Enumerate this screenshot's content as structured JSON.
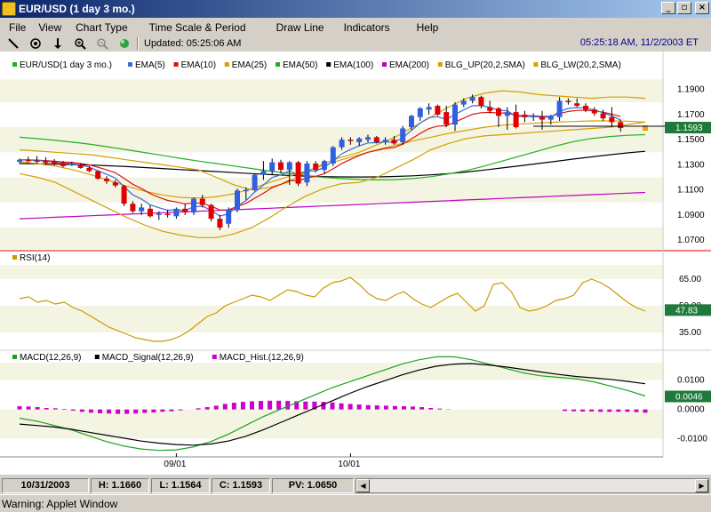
{
  "window": {
    "title": "EUR/USD (1 day  3 mo.)",
    "minimize": "_",
    "restore": "▫",
    "close": "×"
  },
  "menu": [
    "File",
    "View",
    "Chart Type",
    "Time Scale & Period",
    "Draw Line",
    "Indicators",
    "Help"
  ],
  "toolbar": {
    "tools": [
      "pencil-icon",
      "crosshair-icon",
      "arrow-down-icon",
      "zoom-in-icon",
      "zoom-out-icon",
      "globe-icon"
    ],
    "updated": "Updated: 05:25:06 AM",
    "clock": "05:25:18 AM, 11/2/2003 ET"
  },
  "colors": {
    "ema5": "#3b6bd6",
    "ema10": "#e01010",
    "ema25": "#d6a000",
    "ema50": "#20b020",
    "ema100": "#000000",
    "ema200": "#c000c0",
    "bb": "#d0a000",
    "rsi": "#c89a00",
    "macd": "#20a020",
    "signal": "#000000",
    "hist": "#cc00cc",
    "up": "#3060e0",
    "down": "#e00000"
  },
  "price_panel": {
    "legend": [
      {
        "label": "EUR/USD(1 day 3 mo.)",
        "color": "#20b020"
      },
      {
        "label": "EMA(5)",
        "color": "#3b6bd6"
      },
      {
        "label": "EMA(10)",
        "color": "#e01010"
      },
      {
        "label": "EMA(25)",
        "color": "#d6a000"
      },
      {
        "label": "EMA(50)",
        "color": "#20b020"
      },
      {
        "label": "EMA(100)",
        "color": "#000000"
      },
      {
        "label": "EMA(200)",
        "color": "#c000c0"
      },
      {
        "label": "BLG_UP(20,2,SMA)",
        "color": "#d6a000"
      },
      {
        "label": "BLG_LW(20,2,SMA)",
        "color": "#d6a000"
      }
    ],
    "ticks": [
      "1.1900",
      "1.1700",
      "1.1500",
      "1.1300",
      "1.1100",
      "1.0900",
      "1.0700"
    ],
    "ylim": [
      1.063,
      1.199
    ],
    "last_label": "1.1593"
  },
  "rsi_panel": {
    "legend": "RSI(14)",
    "ticks": [
      "65.00",
      "50.00",
      "35.00"
    ],
    "ylim": [
      27,
      73
    ],
    "last_label": "47.83"
  },
  "macd_panel": {
    "legend": [
      {
        "label": "MACD(12,26,9)",
        "color": "#20a020"
      },
      {
        "label": "MACD_Signal(12,26,9)",
        "color": "#000000"
      },
      {
        "label": "MACD_Hist.(12,26,9)",
        "color": "#cc00cc"
      }
    ],
    "ticks": [
      "0.0100",
      "0.0000",
      "-0.0100"
    ],
    "ylim": [
      -0.015,
      0.016
    ],
    "last_label": "0.0046"
  },
  "x_axis": {
    "labels": [
      {
        "text": "09/01",
        "index": 18
      },
      {
        "text": "10/01",
        "index": 38
      }
    ]
  },
  "chart_data": {
    "type": "line",
    "title": "EUR/USD(1 day 3 mo.)",
    "candles": [
      [
        1.1325,
        1.135,
        1.131,
        1.134
      ],
      [
        1.134,
        1.1365,
        1.132,
        1.1335
      ],
      [
        1.1335,
        1.137,
        1.131,
        1.133
      ],
      [
        1.133,
        1.136,
        1.13,
        1.1315
      ],
      [
        1.133,
        1.1345,
        1.1295,
        1.1305
      ],
      [
        1.1315,
        1.133,
        1.128,
        1.129
      ],
      [
        1.1305,
        1.1325,
        1.129,
        1.131
      ],
      [
        1.13,
        1.131,
        1.127,
        1.1275
      ],
      [
        1.1275,
        1.129,
        1.124,
        1.125
      ],
      [
        1.125,
        1.1255,
        1.118,
        1.119
      ],
      [
        1.119,
        1.121,
        1.115,
        1.117
      ],
      [
        1.116,
        1.118,
        1.112,
        1.1135
      ],
      [
        1.113,
        1.114,
        1.097,
        1.099
      ],
      [
        1.099,
        1.101,
        1.0915,
        1.093
      ],
      [
        1.093,
        1.099,
        1.09,
        1.096
      ],
      [
        1.095,
        1.098,
        1.088,
        1.089
      ],
      [
        1.09,
        1.093,
        1.086,
        1.091
      ],
      [
        1.091,
        1.094,
        1.088,
        1.09
      ],
      [
        1.089,
        1.096,
        1.087,
        1.095
      ],
      [
        1.095,
        1.099,
        1.09,
        1.092
      ],
      [
        1.092,
        1.104,
        1.09,
        1.103
      ],
      [
        1.103,
        1.106,
        1.096,
        1.098
      ],
      [
        1.098,
        1.099,
        1.085,
        1.087
      ],
      [
        1.087,
        1.09,
        1.078,
        1.08
      ],
      [
        1.083,
        1.096,
        1.08,
        1.0945
      ],
      [
        1.094,
        1.111,
        1.092,
        1.1095
      ],
      [
        1.109,
        1.112,
        1.102,
        1.11
      ],
      [
        1.11,
        1.123,
        1.109,
        1.122
      ],
      [
        1.122,
        1.133,
        1.118,
        1.125
      ],
      [
        1.125,
        1.135,
        1.122,
        1.132
      ],
      [
        1.132,
        1.134,
        1.123,
        1.126
      ],
      [
        1.126,
        1.133,
        1.114,
        1.132
      ],
      [
        1.132,
        1.133,
        1.113,
        1.115
      ],
      [
        1.116,
        1.133,
        1.113,
        1.131
      ],
      [
        1.131,
        1.133,
        1.124,
        1.126
      ],
      [
        1.126,
        1.134,
        1.123,
        1.133
      ],
      [
        1.131,
        1.145,
        1.129,
        1.144
      ],
      [
        1.144,
        1.152,
        1.142,
        1.15
      ],
      [
        1.15,
        1.152,
        1.146,
        1.149
      ],
      [
        1.148,
        1.152,
        1.145,
        1.151
      ],
      [
        1.15,
        1.154,
        1.148,
        1.152
      ],
      [
        1.152,
        1.153,
        1.147,
        1.148
      ],
      [
        1.148,
        1.152,
        1.146,
        1.15
      ],
      [
        1.15,
        1.153,
        1.146,
        1.147
      ],
      [
        1.148,
        1.161,
        1.146,
        1.159
      ],
      [
        1.16,
        1.17,
        1.158,
        1.169
      ],
      [
        1.168,
        1.176,
        1.165,
        1.175
      ],
      [
        1.174,
        1.179,
        1.17,
        1.176
      ],
      [
        1.177,
        1.178,
        1.169,
        1.17
      ],
      [
        1.172,
        1.177,
        1.16,
        1.162
      ],
      [
        1.162,
        1.18,
        1.157,
        1.178
      ],
      [
        1.178,
        1.183,
        1.176,
        1.181
      ],
      [
        1.181,
        1.186,
        1.179,
        1.184
      ],
      [
        1.184,
        1.185,
        1.175,
        1.177
      ],
      [
        1.176,
        1.181,
        1.171,
        1.173
      ],
      [
        1.175,
        1.176,
        1.16,
        1.169
      ],
      [
        1.169,
        1.176,
        1.158,
        1.172
      ],
      [
        1.172,
        1.178,
        1.159,
        1.16
      ],
      [
        1.17,
        1.173,
        1.164,
        1.168
      ],
      [
        1.168,
        1.171,
        1.165,
        1.169
      ],
      [
        1.168,
        1.173,
        1.158,
        1.166
      ],
      [
        1.166,
        1.17,
        1.162,
        1.169
      ],
      [
        1.168,
        1.184,
        1.165,
        1.181
      ],
      [
        1.181,
        1.183,
        1.178,
        1.18
      ],
      [
        1.179,
        1.183,
        1.176,
        1.177
      ],
      [
        1.177,
        1.179,
        1.172,
        1.174
      ],
      [
        1.174,
        1.176,
        1.169,
        1.171
      ],
      [
        1.171,
        1.174,
        1.165,
        1.167
      ],
      [
        1.168,
        1.176,
        1.16,
        1.164
      ],
      [
        1.164,
        1.166,
        1.1564,
        1.1593
      ]
    ],
    "series": [
      {
        "name": "EMA(50)",
        "values": [
          1.152,
          1.1508,
          1.1495,
          1.148,
          1.1463,
          1.1442,
          1.142,
          1.1398,
          1.1375,
          1.1352,
          1.133,
          1.131,
          1.129,
          1.127,
          1.125,
          1.1232,
          1.1215,
          1.12,
          1.119,
          1.1183,
          1.118,
          1.1182,
          1.119,
          1.1205,
          1.1228,
          1.1255,
          1.129,
          1.133,
          1.137,
          1.141,
          1.145,
          1.1485,
          1.151,
          1.1525,
          1.1535,
          1.154
        ]
      },
      {
        "name": "EMA(100)",
        "values": [
          1.131,
          1.1308,
          1.1305,
          1.1302,
          1.1298,
          1.1292,
          1.1286,
          1.1278,
          1.127,
          1.1262,
          1.1254,
          1.1246,
          1.1238,
          1.123,
          1.1222,
          1.1216,
          1.121,
          1.1206,
          1.1204,
          1.1203,
          1.1204,
          1.1207,
          1.1212,
          1.122,
          1.123,
          1.1243,
          1.1258,
          1.1275,
          1.1292,
          1.131,
          1.1328,
          1.1346,
          1.1363,
          1.138,
          1.1395,
          1.1408
        ]
      },
      {
        "name": "EMA(200)",
        "values": [
          1.087,
          1.0876,
          1.0882,
          1.0888,
          1.0894,
          1.09,
          1.0906,
          1.0912,
          1.0918,
          1.0924,
          1.093,
          1.0936,
          1.0942,
          1.0948,
          1.0954,
          1.096,
          1.0966,
          1.0972,
          1.0978,
          1.0984,
          1.099,
          1.0996,
          1.1002,
          1.1008,
          1.1014,
          1.102,
          1.1026,
          1.1032,
          1.1038,
          1.1044,
          1.105,
          1.1056,
          1.1062,
          1.1068,
          1.1074,
          1.108
        ]
      },
      {
        "name": "EMA(25)",
        "values": [
          1.1325,
          1.131,
          1.129,
          1.126,
          1.122,
          1.1175,
          1.113,
          1.109,
          1.106,
          1.104,
          1.1035,
          1.1045,
          1.107,
          1.111,
          1.116,
          1.1205,
          1.125,
          1.1295,
          1.134,
          1.138,
          1.142,
          1.1455,
          1.149,
          1.152,
          1.155,
          1.1575,
          1.16,
          1.1615,
          1.1625,
          1.1632,
          1.164,
          1.1645,
          1.165,
          1.165,
          1.1648,
          1.164
        ]
      },
      {
        "name": "BLG_UP(20,2,SMA)",
        "values": [
          1.142,
          1.141,
          1.14,
          1.139,
          1.138,
          1.136,
          1.134,
          1.132,
          1.13,
          1.128,
          1.126,
          1.12,
          1.114,
          1.11,
          1.112,
          1.116,
          1.124,
          1.131,
          1.136,
          1.14,
          1.146,
          1.152,
          1.16,
          1.168,
          1.176,
          1.183,
          1.187,
          1.189,
          1.188,
          1.186,
          1.185,
          1.184,
          1.183,
          1.184,
          1.184,
          1.183
        ]
      },
      {
        "name": "BLG_LW(20,2,SMA)",
        "values": [
          1.123,
          1.12,
          1.116,
          1.109,
          1.102,
          1.095,
          1.088,
          1.082,
          1.077,
          1.074,
          1.072,
          1.072,
          1.075,
          1.08,
          1.088,
          1.097,
          1.105,
          1.111,
          1.115,
          1.116,
          1.12,
          1.127,
          1.134,
          1.142,
          1.147,
          1.151,
          1.153,
          1.154,
          1.155,
          1.156,
          1.157,
          1.158,
          1.159,
          1.16,
          1.162,
          1.164
        ]
      },
      {
        "name": "RSI(14)",
        "values": [
          54,
          55,
          52,
          53,
          51,
          52,
          49,
          47,
          44,
          41,
          38,
          36,
          34,
          32,
          31,
          30,
          30,
          31,
          33,
          36,
          40,
          44,
          46,
          50,
          52,
          54,
          56,
          55,
          53,
          56,
          59,
          58,
          56,
          55,
          60,
          63,
          64,
          66,
          62,
          57,
          54,
          53,
          56,
          58,
          54,
          51,
          49,
          52,
          55,
          57,
          52,
          47,
          50,
          62,
          63,
          58,
          49,
          47,
          48,
          50,
          53,
          54,
          56,
          63,
          65,
          63,
          60,
          56,
          52,
          49,
          47
        ]
      },
      {
        "name": "MACD(12,26,9)",
        "values": [
          -0.003,
          -0.004,
          -0.0055,
          -0.007,
          -0.009,
          -0.011,
          -0.0125,
          -0.0135,
          -0.014,
          -0.0138,
          -0.0128,
          -0.011,
          -0.0085,
          -0.0055,
          -0.0025,
          0.0,
          0.0025,
          0.005,
          0.0075,
          0.0095,
          0.0115,
          0.0135,
          0.0155,
          0.017,
          0.018,
          0.018,
          0.017,
          0.0155,
          0.014,
          0.0125,
          0.0115,
          0.011,
          0.0105,
          0.0095,
          0.008,
          0.0065,
          0.0046
        ]
      },
      {
        "name": "MACD_Signal(12,26,9)",
        "values": [
          -0.005,
          -0.0055,
          -0.006,
          -0.0068,
          -0.0078,
          -0.0088,
          -0.0098,
          -0.0108,
          -0.0115,
          -0.012,
          -0.0122,
          -0.0118,
          -0.0108,
          -0.0092,
          -0.007,
          -0.0045,
          -0.002,
          0.0005,
          0.003,
          0.0055,
          0.0078,
          0.0098,
          0.0118,
          0.0135,
          0.0148,
          0.0155,
          0.0157,
          0.0152,
          0.0145,
          0.0137,
          0.0128,
          0.012,
          0.0113,
          0.0108,
          0.0103,
          0.0096,
          0.0088
        ]
      },
      {
        "name": "MACD_Hist.(12,26,9)",
        "values": [
          0.0011,
          0.001,
          0.0008,
          0.0005,
          0.0004,
          0.0002,
          -0.0004,
          -0.0008,
          -0.0011,
          -0.0013,
          -0.0014,
          -0.0015,
          -0.0015,
          -0.0014,
          -0.0012,
          -0.001,
          -0.0008,
          -0.0006,
          -0.0003,
          0.0,
          0.0004,
          0.0008,
          0.0013,
          0.0019,
          0.0023,
          0.0026,
          0.0028,
          0.0029,
          0.003,
          0.003,
          0.0029,
          0.0028,
          0.0027,
          0.0027,
          0.0026,
          0.0024,
          0.0021,
          0.0019,
          0.0017,
          0.0015,
          0.0014,
          0.0013,
          0.0012,
          0.0011,
          0.001,
          0.0008,
          0.0005,
          0.0003,
          0.0001,
          0.0,
          0.0,
          0.0,
          0.0,
          0.0,
          0.0,
          0.0,
          0.0,
          0.0,
          0.0,
          0.0,
          0.0,
          -0.0005,
          -0.0006,
          -0.0007,
          -0.0007,
          -0.0008,
          -0.0008,
          -0.0008,
          -0.0008,
          -0.0009,
          -0.0011
        ]
      }
    ]
  },
  "status": {
    "date": "10/31/2003",
    "high": "H: 1.1660",
    "low": "L: 1.1564",
    "close": "C: 1.1593",
    "pv": "PV: 1.0650"
  },
  "warning": "Warning: Applet Window"
}
